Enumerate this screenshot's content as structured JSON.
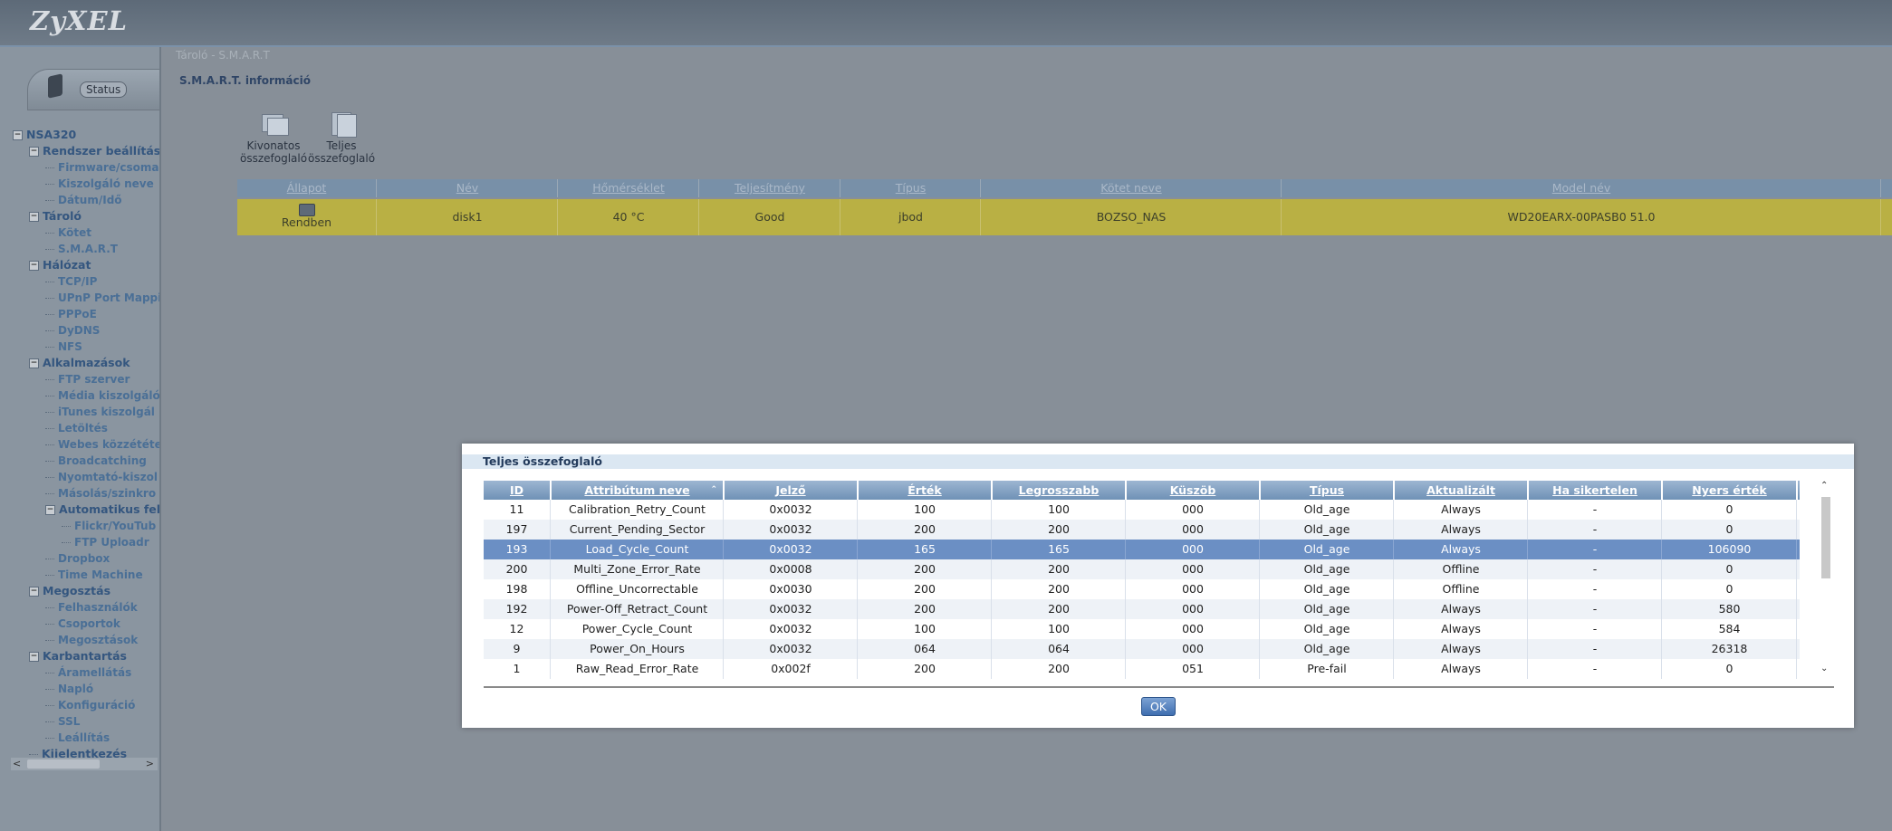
{
  "app": {
    "logo": "ZyXEL"
  },
  "sidebar": {
    "status_label": "Status",
    "tree": [
      {
        "label": "NSA320",
        "level": 0,
        "type": "root"
      },
      {
        "label": "Rendszer beállítás",
        "level": 1,
        "type": "group"
      },
      {
        "label": "Firmware/csoma",
        "level": 2,
        "type": "leaf"
      },
      {
        "label": "Kiszolgáló neve",
        "level": 2,
        "type": "leaf"
      },
      {
        "label": "Dátum/Idő",
        "level": 2,
        "type": "leaf"
      },
      {
        "label": "Tároló",
        "level": 1,
        "type": "group"
      },
      {
        "label": "Kötet",
        "level": 2,
        "type": "leaf"
      },
      {
        "label": "S.M.A.R.T",
        "level": 2,
        "type": "leaf"
      },
      {
        "label": "Hálózat",
        "level": 1,
        "type": "group"
      },
      {
        "label": "TCP/IP",
        "level": 2,
        "type": "leaf"
      },
      {
        "label": "UPnP Port Mappi",
        "level": 2,
        "type": "leaf"
      },
      {
        "label": "PPPoE",
        "level": 2,
        "type": "leaf"
      },
      {
        "label": "DyDNS",
        "level": 2,
        "type": "leaf"
      },
      {
        "label": "NFS",
        "level": 2,
        "type": "leaf"
      },
      {
        "label": "Alkalmazások",
        "level": 1,
        "type": "group"
      },
      {
        "label": "FTP szerver",
        "level": 2,
        "type": "leaf"
      },
      {
        "label": "Média kiszolgáló",
        "level": 2,
        "type": "leaf"
      },
      {
        "label": "iTunes kiszolgál",
        "level": 2,
        "type": "leaf"
      },
      {
        "label": "Letöltés",
        "level": 2,
        "type": "leaf"
      },
      {
        "label": "Webes közzététe",
        "level": 2,
        "type": "leaf"
      },
      {
        "label": "Broadcatching",
        "level": 2,
        "type": "leaf"
      },
      {
        "label": "Nyomtató-kiszol",
        "level": 2,
        "type": "leaf"
      },
      {
        "label": "Másolás/szinkro",
        "level": 2,
        "type": "leaf"
      },
      {
        "label": "Automatikus felt",
        "level": 2,
        "type": "group"
      },
      {
        "label": "Flickr/YouTub",
        "level": 3,
        "type": "leaf"
      },
      {
        "label": "FTP Uploadr",
        "level": 3,
        "type": "leaf"
      },
      {
        "label": "Dropbox",
        "level": 2,
        "type": "leaf"
      },
      {
        "label": "Time Machine",
        "level": 2,
        "type": "leaf"
      },
      {
        "label": "Megosztás",
        "level": 1,
        "type": "group"
      },
      {
        "label": "Felhasználók",
        "level": 2,
        "type": "leaf"
      },
      {
        "label": "Csoportok",
        "level": 2,
        "type": "leaf"
      },
      {
        "label": "Megosztások",
        "level": 2,
        "type": "leaf"
      },
      {
        "label": "Karbantartás",
        "level": 1,
        "type": "group"
      },
      {
        "label": "Áramellátás",
        "level": 2,
        "type": "leaf"
      },
      {
        "label": "Napló",
        "level": 2,
        "type": "leaf"
      },
      {
        "label": "Konfiguráció",
        "level": 2,
        "type": "leaf"
      },
      {
        "label": "SSL",
        "level": 2,
        "type": "leaf"
      },
      {
        "label": "Leállítás",
        "level": 2,
        "type": "leaf"
      },
      {
        "label": "Kijelentkezés",
        "level": 1,
        "type": "single"
      }
    ]
  },
  "content": {
    "breadcrumb": "Tároló - S.M.A.R.T",
    "section_title": "S.M.A.R.T. információ",
    "toolbar": {
      "summary_label": "Kivonatos összefoglaló",
      "full_label": "Teljes összefoglaló"
    },
    "disk_table": {
      "headers": [
        "Állapot",
        "Név",
        "Hőmérséklet",
        "Teljesítmény",
        "Típus",
        "Kötet neve",
        "Model név"
      ],
      "row": {
        "status": "Rendben",
        "name": "disk1",
        "temperature": "40 °C",
        "performance": "Good",
        "type": "jbod",
        "volume": "BOZSO_NAS",
        "model": "WD20EARX-00PASB0 51.0"
      }
    }
  },
  "modal": {
    "title": "Teljes összefoglaló",
    "headers": [
      "ID",
      "Attribútum neve",
      "Jelző",
      "Érték",
      "Legrosszabb",
      "Küszöb",
      "Típus",
      "Aktualizált",
      "Ha sikertelen",
      "Nyers érték"
    ],
    "rows": [
      [
        "11",
        "Calibration_Retry_Count",
        "0x0032",
        "100",
        "100",
        "000",
        "Old_age",
        "Always",
        "-",
        "0"
      ],
      [
        "197",
        "Current_Pending_Sector",
        "0x0032",
        "200",
        "200",
        "000",
        "Old_age",
        "Always",
        "-",
        "0"
      ],
      [
        "193",
        "Load_Cycle_Count",
        "0x0032",
        "165",
        "165",
        "000",
        "Old_age",
        "Always",
        "-",
        "106090"
      ],
      [
        "200",
        "Multi_Zone_Error_Rate",
        "0x0008",
        "200",
        "200",
        "000",
        "Old_age",
        "Offline",
        "-",
        "0"
      ],
      [
        "198",
        "Offline_Uncorrectable",
        "0x0030",
        "200",
        "200",
        "000",
        "Old_age",
        "Offline",
        "-",
        "0"
      ],
      [
        "192",
        "Power-Off_Retract_Count",
        "0x0032",
        "200",
        "200",
        "000",
        "Old_age",
        "Always",
        "-",
        "580"
      ],
      [
        "12",
        "Power_Cycle_Count",
        "0x0032",
        "100",
        "100",
        "000",
        "Old_age",
        "Always",
        "-",
        "584"
      ],
      [
        "9",
        "Power_On_Hours",
        "0x0032",
        "064",
        "064",
        "000",
        "Old_age",
        "Always",
        "-",
        "26318"
      ],
      [
        "1",
        "Raw_Read_Error_Rate",
        "0x002f",
        "200",
        "200",
        "051",
        "Pre-fail",
        "Always",
        "-",
        "0"
      ]
    ],
    "selected_row": 2,
    "ok_label": "OK"
  }
}
